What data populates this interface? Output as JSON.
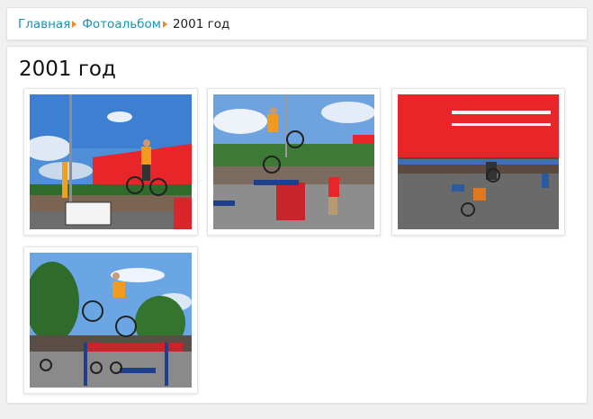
{
  "breadcrumb": {
    "items": [
      "Главная",
      "Фотоальбом"
    ],
    "current": "2001 год"
  },
  "page_title": "2001 год",
  "colors": {
    "link": "#1a93b0",
    "separator": "#f08a24",
    "building": "#e8262a"
  },
  "photos": [
    {
      "subject": "bike-trial-jump-photo"
    },
    {
      "subject": "bike-trial-platform-photo"
    },
    {
      "subject": "bike-trial-crowd-photo"
    },
    {
      "subject": "bike-trial-ramp-photo"
    }
  ]
}
